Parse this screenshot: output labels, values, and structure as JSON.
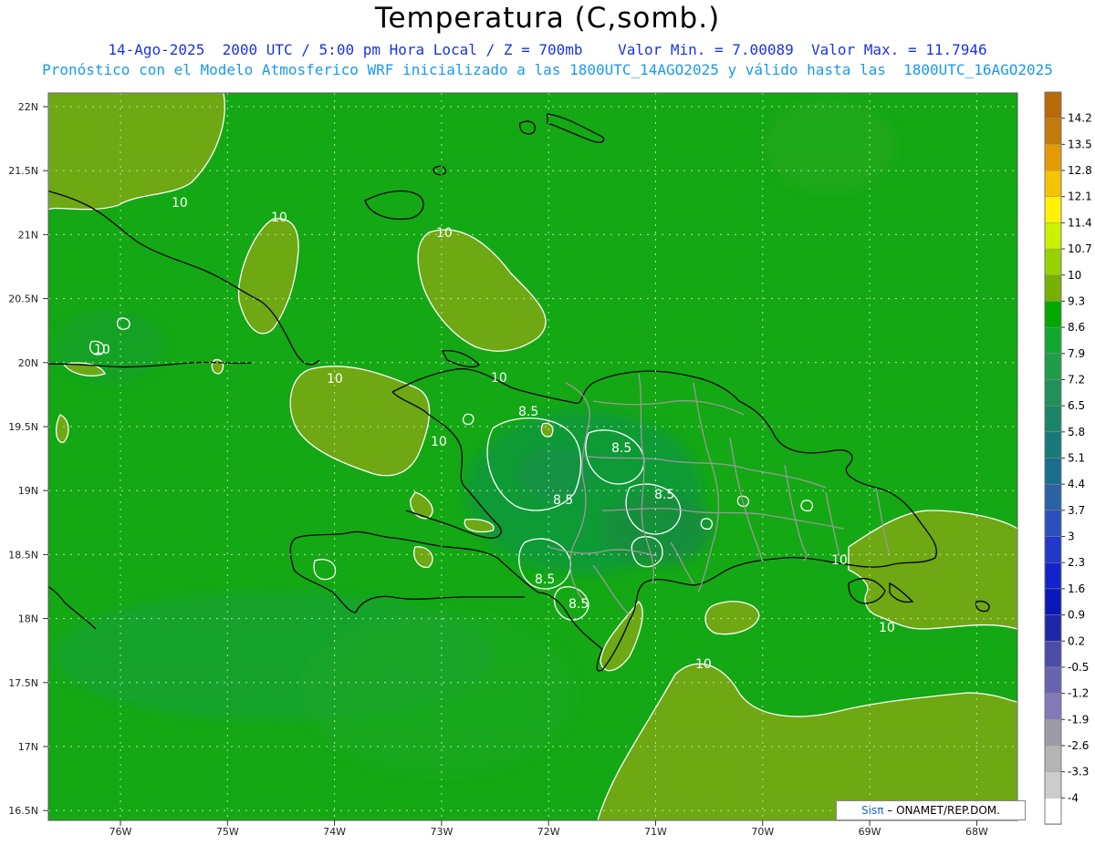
{
  "header": {
    "title": "Temperatura (C,somb.)",
    "line1": "14-Ago-2025  2000 UTC / 5:00 pm Hora Local / Z = 700mb    Valor Min. = 7.00089  Valor Max. = 11.7946",
    "line2": "Pronóstico con el Modelo Atmosferico WRF inicializado a las 1800UTC_14AGO2025 y válido hasta las  1800UTC_16AGO2025"
  },
  "axes": {
    "lat_labels": [
      "22N",
      "21.5N",
      "21N",
      "20.5N",
      "20N",
      "19.5N",
      "19N",
      "18.5N",
      "18N",
      "17.5N",
      "17N",
      "16.5N"
    ],
    "lon_labels": [
      "76W",
      "75W",
      "74W",
      "73W",
      "72W",
      "71W",
      "70W",
      "69W",
      "68W"
    ]
  },
  "colorbar": {
    "labels": [
      "14.2",
      "13.5",
      "12.8",
      "12.1",
      "11.4",
      "10.7",
      "10",
      "9.3",
      "8.6",
      "7.9",
      "7.2",
      "6.5",
      "5.8",
      "5.1",
      "4.4",
      "3.7",
      "3",
      "2.3",
      "1.6",
      "0.9",
      "0.2",
      "-0.5",
      "-1.2",
      "-1.9",
      "-2.6",
      "-3.3",
      "-4"
    ],
    "colors": [
      "#c27a0a",
      "#e49b00",
      "#f5c400",
      "#fff200",
      "#ccf000",
      "#97d100",
      "#78b000",
      "#00a800",
      "#11a830",
      "#1f9e48",
      "#22905a",
      "#1c8567",
      "#177a78",
      "#1a6d8c",
      "#2a62a4",
      "#2a50bb",
      "#2039c8",
      "#1224c9",
      "#0a18b8",
      "#1e26aa",
      "#4a4ca8",
      "#6a64b0",
      "#8478b8",
      "#9e9aa8",
      "#b4b4b4",
      "#cccccc",
      "#ffffff"
    ]
  },
  "contour_labels": [
    "10",
    "10",
    "10",
    "10",
    "10",
    "10",
    "10",
    "10",
    "10",
    "10",
    "8.5",
    "8.5",
    "8.5",
    "8.5",
    "8.5",
    "8.5",
    "10",
    "10"
  ],
  "credit": {
    "sis": "Sisπ",
    "rest": " – ONAMET/REP.DOM."
  },
  "colors": {
    "field_main": "#14a814",
    "warm_zone": "#6ea812",
    "cool_zone": "#129a3a",
    "contour": "#ffffff",
    "coast": "#000000",
    "provinces": "#9a9a9a"
  }
}
